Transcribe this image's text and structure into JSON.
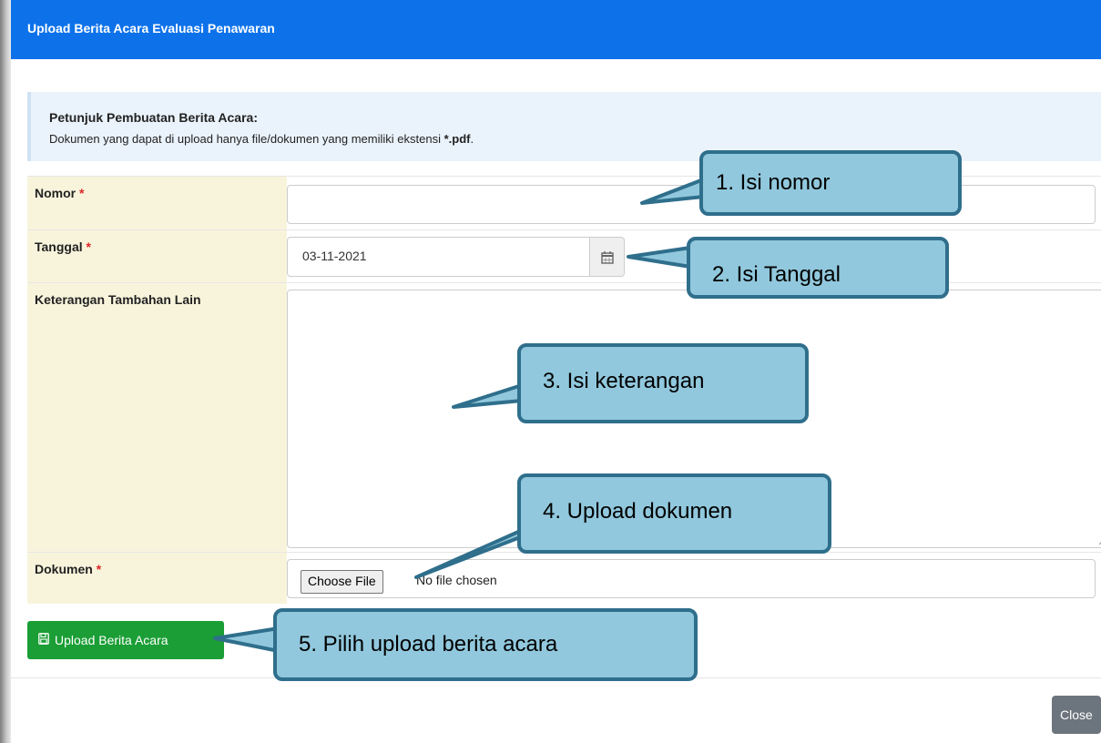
{
  "dialog": {
    "title": "Upload Berita Acara Evaluasi Penawaran"
  },
  "info": {
    "title": "Petunjuk Pembuatan Berita Acara:",
    "text": "Dokumen yang dapat di upload hanya file/dokumen yang memiliki ekstensi ",
    "ext": "*.pdf",
    "period": "."
  },
  "form": {
    "nomor_label": "Nomor",
    "nomor_value": "",
    "tanggal_label": "Tanggal",
    "tanggal_value": "03-11-2021",
    "keterangan_label": "Keterangan Tambahan Lain",
    "keterangan_value": "",
    "dokumen_label": "Dokumen",
    "choose_file": "Choose File",
    "no_file": "No file chosen",
    "required_mark": "*"
  },
  "buttons": {
    "upload": "Upload Berita Acara",
    "close": "Close"
  },
  "callouts": {
    "c1": "1.  Isi nomor",
    "c2": "2. Isi Tanggal",
    "c3": "3. Isi keterangan",
    "c4": "4. Upload dokumen",
    "c5": "5. Pilih upload berita acara"
  },
  "colors": {
    "header": "#0d72ea",
    "label_bg": "#f8f4dc",
    "upload_btn": "#1a9e35",
    "callout_fill": "#91c8dd",
    "callout_border": "#2f6f8c"
  }
}
